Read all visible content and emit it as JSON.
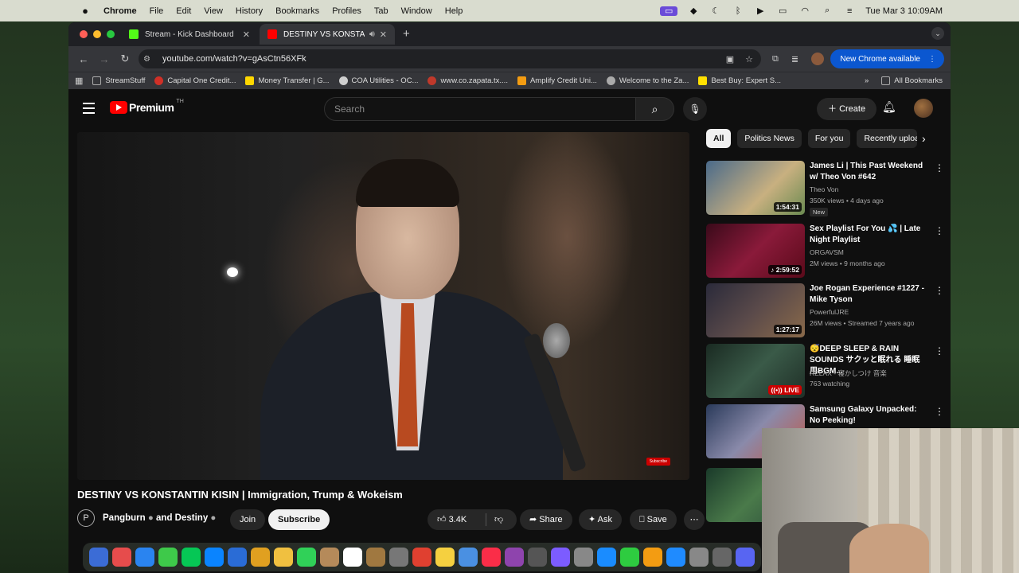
{
  "menubar": {
    "apple": "",
    "app": "Chrome",
    "items": [
      "File",
      "Edit",
      "View",
      "History",
      "Bookmarks",
      "Profiles",
      "Tab",
      "Window",
      "Help"
    ],
    "clock": "Tue Mar 3  10:09AM"
  },
  "tabs": [
    {
      "title": "Stream - Kick Dashboard",
      "favicon_color": "#53fc18"
    },
    {
      "title": "DESTINY VS KONSTANTIN",
      "favicon_color": "#ff0000",
      "active": true
    }
  ],
  "address": {
    "url": "youtube.com/watch?v=gAsCtn56XFk"
  },
  "new_chrome": "New Chrome available",
  "bookmarks": [
    {
      "label": "StreamStuff",
      "color": "#999"
    },
    {
      "label": "Capital One Credit...",
      "color": "#d03027"
    },
    {
      "label": "Money Transfer | G...",
      "color": "#ffd700"
    },
    {
      "label": "COA Utilities - OC...",
      "color": "#cfcfcf"
    },
    {
      "label": "www.co.zapata.tx....",
      "color": "#c0392b"
    },
    {
      "label": "Amplify Credit Uni...",
      "color": "#f39c12"
    },
    {
      "label": "Welcome to the Za...",
      "color": "#aaaaaa"
    },
    {
      "label": "Best Buy: Expert S...",
      "color": "#ffe000"
    }
  ],
  "all_bookmarks": "All Bookmarks",
  "youtube": {
    "logo_text": "Premium",
    "logo_super": "TH",
    "search_placeholder": "Search",
    "create_label": "Create",
    "video_title": "DESTINY VS KONSTANTIN KISIN | Immigration, Trump & Wokeism",
    "channel": "Pangburn",
    "channel_and": "and Destiny",
    "join": "Join",
    "subscribe": "Subscribe",
    "likes": "3.4K",
    "share": "Share",
    "ask": "Ask",
    "save": "Save",
    "watermark": "Subscribe"
  },
  "chips": [
    "All",
    "Politics News",
    "For you",
    "Recently uploaded"
  ],
  "recommendations": [
    {
      "title": "James Li | This Past Weekend w/ Theo Von #642",
      "channel": "Theo Von",
      "meta": "350K views • 4 days ago",
      "duration": "1:54:31",
      "badge": "New",
      "thumb": "linear-gradient(135deg,#4a6a8a,#c8b080 60%,#6a8a50)"
    },
    {
      "title": "Sex Playlist For You 💦 | Late Night Playlist",
      "channel": "ORGAVSM",
      "meta": "2M views • 9 months ago",
      "duration": "♪ 2:59:52",
      "thumb": "linear-gradient(135deg,#3a0a1a,#8a1a3a 50%,#5a0a1a)"
    },
    {
      "title": "Joe Rogan Experience #1227 - Mike Tyson",
      "channel": "PowerfulJRE",
      "meta": "26M views • Streamed 7 years ago",
      "duration": "1:27:17",
      "thumb": "linear-gradient(135deg,#2a2a3a,#5a4a4a 50%,#8a6a4a)"
    },
    {
      "title": "😴DEEP SLEEP & RAIN SOUNDS サクッと眠れる 睡眠用BGM...",
      "channel": "RELAX - 寝かしつけ 音楽",
      "meta": "763 watching",
      "duration": "((•)) LIVE",
      "live": true,
      "thumb": "linear-gradient(135deg,#1a2a22,#3a5a48 50%,#1f2f27)"
    },
    {
      "title": "Samsung Galaxy Unpacked: No Peeking!",
      "channel": "",
      "meta": "",
      "duration": "",
      "thumb": "linear-gradient(135deg,#2a3a5a,#8a8aaa 50%,#c05a4a)"
    },
    {
      "title": "",
      "channel": "",
      "meta": "",
      "duration": "",
      "thumb": "linear-gradient(135deg,#1a3a2a,#4a7a4a 50%,#2a4a3a)"
    }
  ],
  "dock_colors": [
    "#3b6cd6",
    "#e64c4c",
    "#2a84f0",
    "#3ec94a",
    "#06c755",
    "#0a84ff",
    "#2a6cd6",
    "#e0a020",
    "#f0c040",
    "#30d158",
    "#b58a5a",
    "#ffffff",
    "#a07840",
    "#777",
    "#e04030",
    "#f5d040",
    "#4a90e2",
    "#fa2d48",
    "#8e44ad",
    "#555",
    "#7c5cff",
    "#888",
    "#1a8cff",
    "#2ecc40",
    "#f39c12",
    "#1f8bff",
    "#888",
    "#666",
    "#5865f2"
  ]
}
